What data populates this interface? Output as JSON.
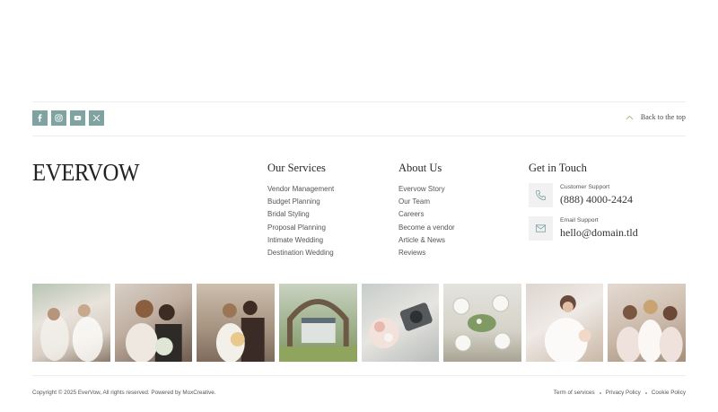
{
  "social": {
    "icons": [
      "facebook-icon",
      "instagram-icon",
      "youtube-icon",
      "x-twitter-icon"
    ],
    "accent": "#7fa3a0"
  },
  "back_to_top": {
    "label": "Back to the top"
  },
  "brand": {
    "logo": "EVERVOW"
  },
  "services": {
    "title": "Our Services",
    "items": [
      "Vendor Management",
      "Budget Planning",
      "Bridal Styling",
      "Proposal Planning",
      "Intimate Wedding",
      "Destination Wedding"
    ]
  },
  "about": {
    "title": "About Us",
    "items": [
      "Evervow Story",
      "Our Team",
      "Careers",
      "Become a vendor",
      "Article & News",
      "Reviews"
    ]
  },
  "contact": {
    "title": "Get in Touch",
    "phone_label": "Customer Support",
    "phone": "(888) 4000-2424",
    "email_label": "Email Support",
    "email": "hello@domain.tld"
  },
  "footer": {
    "copyright": "Copyright © 2025 EverVow, All rights reserved. Powered by MoxCreative.",
    "links": [
      "Term of services",
      "Privacy Policy",
      "Cookie Policy"
    ]
  }
}
